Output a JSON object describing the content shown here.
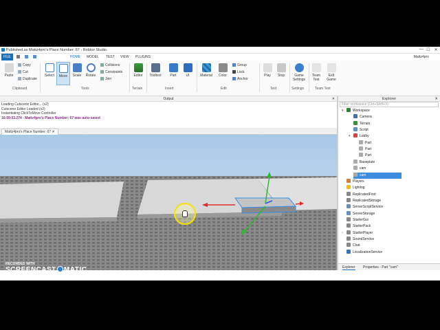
{
  "window": {
    "title": "Published as Mattz4pro's Place Number: 67 - Roblox Studio",
    "minimize": "—",
    "maximize": "☐",
    "close": "✕"
  },
  "menubar": {
    "file": "FILE",
    "tabs": [
      "HOME",
      "MODEL",
      "TEST",
      "VIEW",
      "PLUGINS"
    ],
    "active_tab": "HOME",
    "username": "Mattz4pro"
  },
  "ribbon": {
    "clipboard": {
      "paste": "Paste",
      "copy": "Copy",
      "cut": "Cut",
      "duplicate": "Duplicate",
      "group_label": "Clipboard"
    },
    "tools": {
      "select": "Select",
      "move": "Move",
      "scale": "Scale",
      "rotate": "Rotate",
      "collisions": "Collisions",
      "constraints": "Constraints",
      "join": "Join",
      "group_label": "Tools"
    },
    "terrain": {
      "editor": "Editor",
      "group_label": "Terrain"
    },
    "insert": {
      "toolbox": "Toolbox",
      "part": "Part",
      "ui": "UI",
      "group_label": "Insert"
    },
    "edit": {
      "material": "Material",
      "color": "Color",
      "group": "Group",
      "lock": "Lock",
      "anchor": "Anchor",
      "group_label": "Edit"
    },
    "test": {
      "play": "Play",
      "stop": "Stop",
      "group_label": "Test"
    },
    "settings": {
      "game_settings": "Game Settings",
      "group_label": "Settings"
    },
    "team_test": {
      "team_test": "Team Test",
      "exit_game": "Exit Game",
      "group_label": "Team Test"
    }
  },
  "output": {
    "title": "Output",
    "lines": [
      "Loading Cutscene Editor... (x2)",
      "Cutscene Editor Loaded (x2)",
      "Instantiating ClickToMove Controller",
      "16:39:53.274 - Mattz4pro's Place Number: 67 was auto-saved"
    ]
  },
  "document_tab": "Mattz4pro's Place Number: 67",
  "explorer": {
    "title": "Explorer",
    "filter_placeholder": "Filter workspace (Ctrl+Shift+X)",
    "nodes": [
      {
        "label": "Workspace",
        "color": "#3b7a3b"
      },
      {
        "label": "Camera",
        "color": "#4a6fa5"
      },
      {
        "label": "Terrain",
        "color": "#3b8e3b"
      },
      {
        "label": "Script",
        "color": "#5d8fd0"
      },
      {
        "label": "Lobby",
        "color": "#c84848"
      },
      {
        "label": "Part",
        "color": "#aaaaaa"
      },
      {
        "label": "Part",
        "color": "#aaaaaa"
      },
      {
        "label": "Part",
        "color": "#aaaaaa"
      },
      {
        "label": "Baseplate",
        "color": "#aaaaaa"
      },
      {
        "label": "cam",
        "color": "#aaaaaa"
      },
      {
        "label": "cam",
        "color": "#aaaaaa"
      },
      {
        "label": "Players",
        "color": "#d0803a"
      },
      {
        "label": "Lighting",
        "color": "#e8c020"
      },
      {
        "label": "ReplicatedFirst",
        "color": "#888888"
      },
      {
        "label": "ReplicatedStorage",
        "color": "#888888"
      },
      {
        "label": "ServerScriptService",
        "color": "#6a8fb8"
      },
      {
        "label": "ServerStorage",
        "color": "#6a8fb8"
      },
      {
        "label": "StarterGui",
        "color": "#888888"
      },
      {
        "label": "StarterPack",
        "color": "#888888"
      },
      {
        "label": "StarterPlayer",
        "color": "#888888"
      },
      {
        "label": "SoundService",
        "color": "#888888"
      },
      {
        "label": "Chat",
        "color": "#888888"
      },
      {
        "label": "LocalizationService",
        "color": "#3a70c0"
      }
    ],
    "tabs": [
      "Explorer",
      "Properties - Part \"cam\""
    ]
  },
  "watermark": {
    "line1": "RECORDED WITH",
    "line2a": "SCREENCAST",
    "line2b": "MATIC"
  }
}
